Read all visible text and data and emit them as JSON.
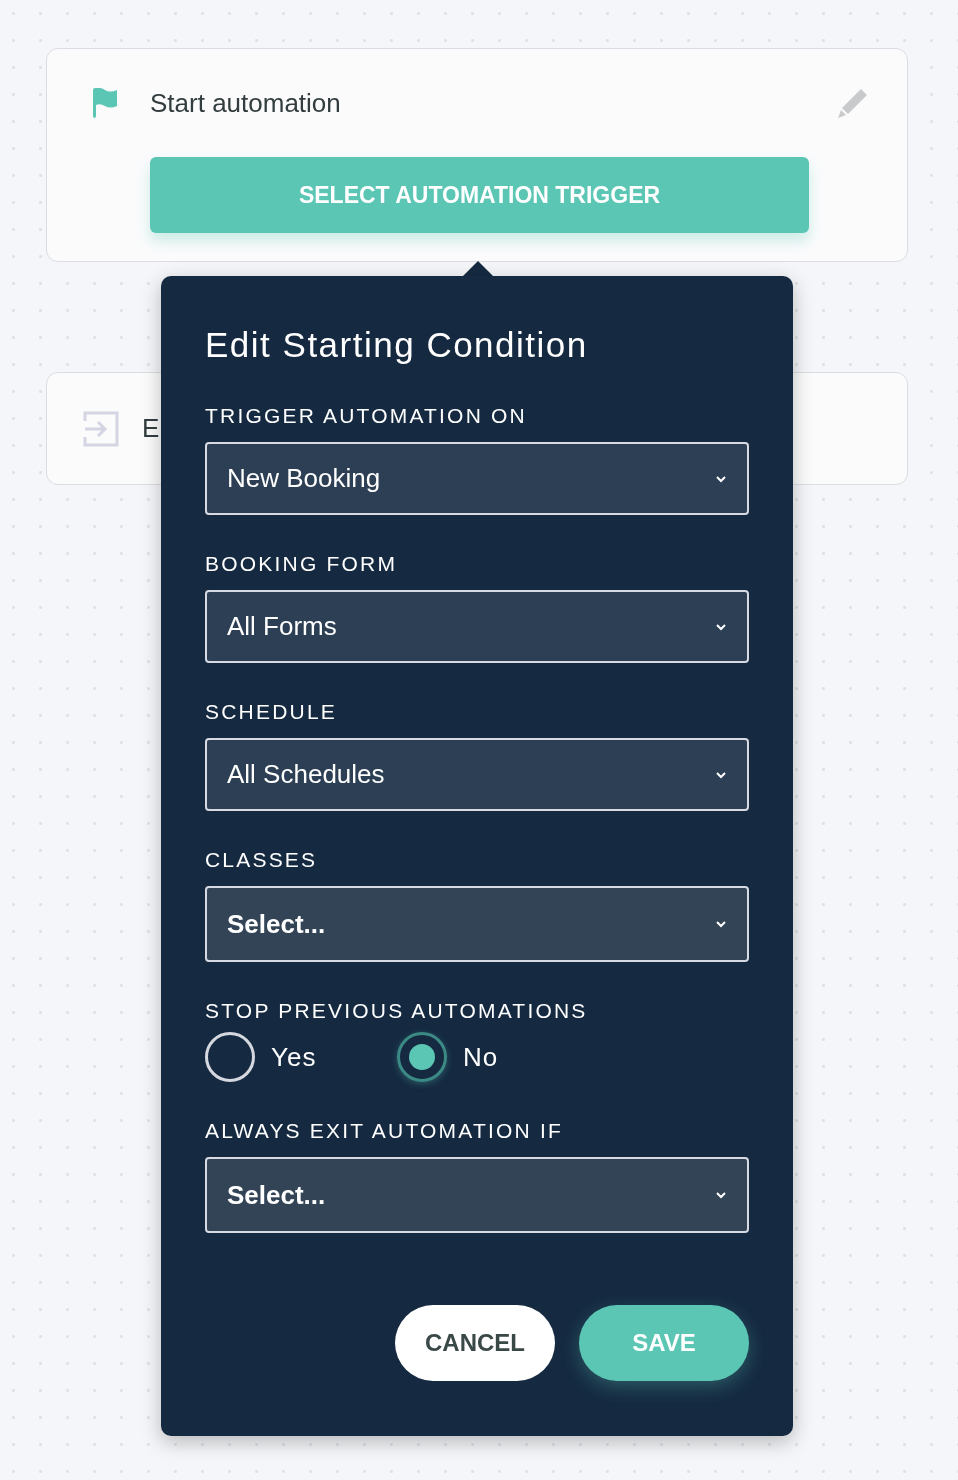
{
  "cards": [
    {
      "kind": "trigger",
      "title": "Start automation",
      "button": "SELECT AUTOMATION TRIGGER"
    },
    {
      "kind": "exit",
      "title": "E"
    }
  ],
  "popover": {
    "title": "Edit Starting Condition",
    "fields": [
      {
        "kind": "select",
        "label": "TRIGGER AUTOMATION ON",
        "value": "New Booking"
      },
      {
        "kind": "select",
        "label": "BOOKING FORM",
        "value": "All Forms"
      },
      {
        "kind": "select",
        "label": "SCHEDULE",
        "value": "All Schedules"
      },
      {
        "kind": "select",
        "label": "CLASSES",
        "placeholder": "Select..."
      },
      {
        "kind": "radio",
        "label": "STOP PREVIOUS AUTOMATIONS",
        "options": [
          {
            "label": "Yes",
            "selected": false
          },
          {
            "label": "No",
            "selected": true
          }
        ]
      },
      {
        "kind": "select",
        "label": "ALWAYS EXIT AUTOMATION IF",
        "placeholder": "Select..."
      }
    ],
    "buttons": [
      {
        "kind": "secondary",
        "label": "CANCEL"
      },
      {
        "kind": "primary",
        "label": "SAVE"
      }
    ]
  }
}
